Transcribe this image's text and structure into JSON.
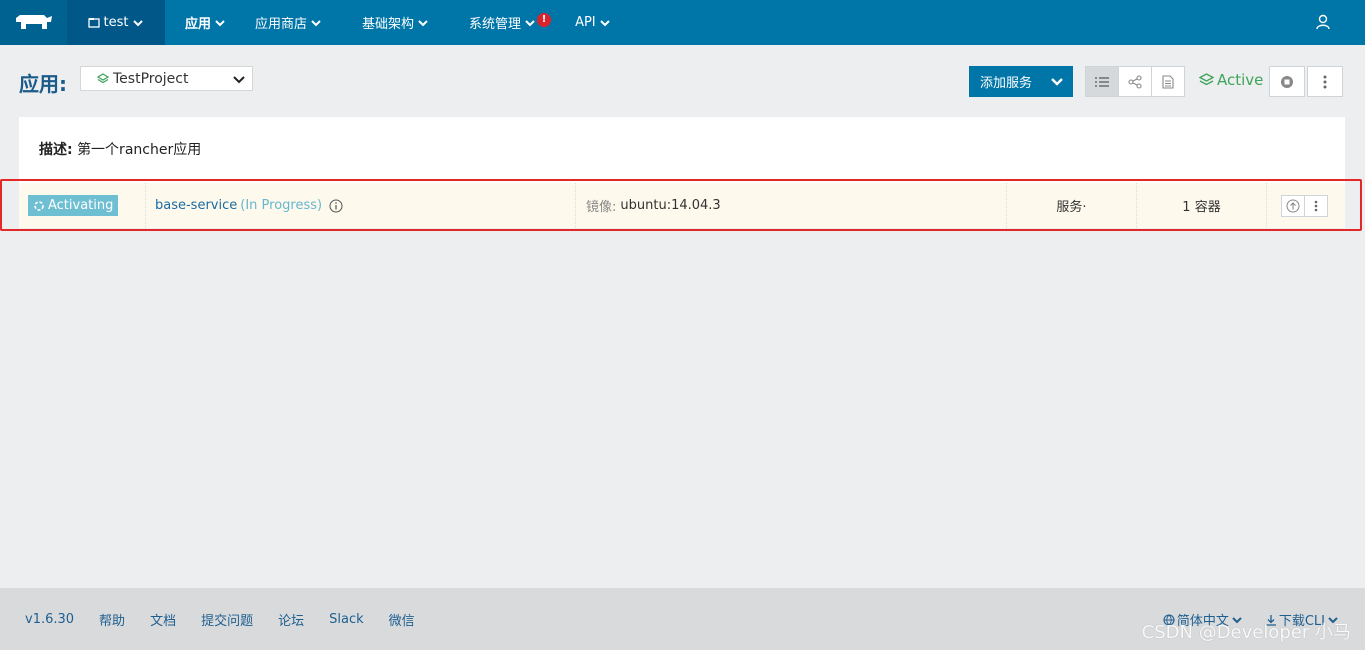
{
  "nav": {
    "env_label": "test",
    "items": [
      {
        "label": "应用",
        "active": true
      },
      {
        "label": "应用商店"
      },
      {
        "label": "基础架构"
      },
      {
        "label": "系统管理",
        "alert": "!"
      },
      {
        "label": "API"
      }
    ]
  },
  "header": {
    "title": "应用:",
    "project": "TestProject",
    "add_service": "添加服务",
    "state": "Active"
  },
  "panel": {
    "desc_label": "描述:",
    "desc_text": "第一个rancher应用",
    "row": {
      "state": "Activating",
      "service_name": "base-service",
      "service_progress": "(In Progress)",
      "image_label": "镜像:",
      "image_value": "ubuntu:14.04.3",
      "kind": "服务·",
      "containers": "1 容器"
    }
  },
  "footer": {
    "links": [
      "v1.6.30",
      "帮助",
      "文档",
      "提交问题",
      "论坛",
      "Slack",
      "微信"
    ],
    "language": "简体中文",
    "download": "下载CLI"
  },
  "watermark": "CSDN @Developer 小马",
  "colors": {
    "nav_bg": "#0075a8",
    "accent": "#0075a8",
    "active_green": "#3fa35a",
    "activating": "#6fbfd3",
    "highlight": "#e42728"
  }
}
